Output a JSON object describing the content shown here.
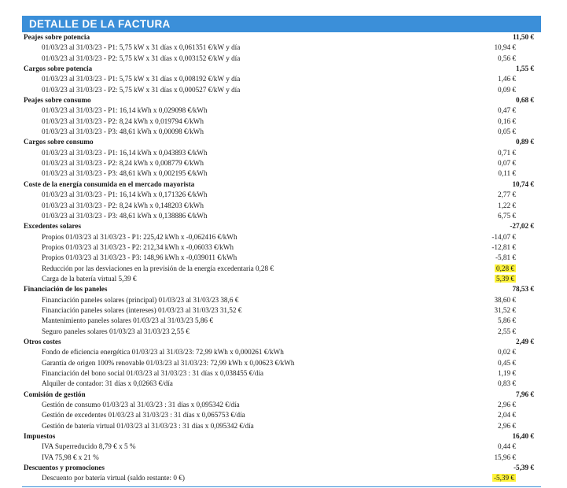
{
  "title": "DETALLE DE LA FACTURA",
  "sections": [
    {
      "label": "Peajes sobre potencia",
      "amount": "11,50 €",
      "items": [
        {
          "label": "01/03/23 al 31/03/23 - P1: 5,75 kW x 31 días x 0,061351 €/kW y día",
          "amount": "10,94 €"
        },
        {
          "label": "01/03/23 al 31/03/23 - P2: 5,75 kW x 31 días x 0,003152 €/kW y día",
          "amount": "0,56 €"
        }
      ]
    },
    {
      "label": "Cargos sobre potencia",
      "amount": "1,55 €",
      "items": [
        {
          "label": "01/03/23 al 31/03/23 - P1: 5,75 kW x 31 días x 0,008192 €/kW y día",
          "amount": "1,46 €"
        },
        {
          "label": "01/03/23 al 31/03/23 - P2: 5,75 kW x 31 días x 0,000527 €/kW y día",
          "amount": "0,09 €"
        }
      ]
    },
    {
      "label": "Peajes sobre consumo",
      "amount": "0,68 €",
      "items": [
        {
          "label": "01/03/23 al 31/03/23 - P1: 16,14 kWh x 0,029098 €/kWh",
          "amount": "0,47 €"
        },
        {
          "label": "01/03/23 al 31/03/23 - P2: 8,24 kWh x 0,019794 €/kWh",
          "amount": "0,16 €"
        },
        {
          "label": "01/03/23 al 31/03/23 - P3: 48,61 kWh x 0,00098 €/kWh",
          "amount": "0,05 €"
        }
      ]
    },
    {
      "label": "Cargos sobre consumo",
      "amount": "0,89 €",
      "items": [
        {
          "label": "01/03/23 al 31/03/23 - P1: 16,14 kWh x 0,043893 €/kWh",
          "amount": "0,71 €"
        },
        {
          "label": "01/03/23 al 31/03/23 - P2: 8,24 kWh x 0,008779 €/kWh",
          "amount": "0,07 €"
        },
        {
          "label": "01/03/23 al 31/03/23 - P3: 48,61 kWh x 0,002195 €/kWh",
          "amount": "0,11 €"
        }
      ]
    },
    {
      "label": "Coste de la energía consumida en el mercado mayorista",
      "amount": "10,74 €",
      "items": [
        {
          "label": "01/03/23 al 31/03/23 - P1: 16,14 kWh x 0,171326 €/kWh",
          "amount": "2,77 €"
        },
        {
          "label": "01/03/23 al 31/03/23 - P2: 8,24 kWh x 0,148203 €/kWh",
          "amount": "1,22 €"
        },
        {
          "label": "01/03/23 al 31/03/23 - P3: 48,61 kWh x 0,138886 €/kWh",
          "amount": "6,75 €"
        }
      ]
    },
    {
      "label": "Excedentes solares",
      "amount": "-27,02 €",
      "items": [
        {
          "label": "Propios 01/03/23 al 31/03/23 - P1: 225,42 kWh x -0,062416 €/kWh",
          "amount": "-14,07 €"
        },
        {
          "label": "Propios 01/03/23 al 31/03/23 - P2: 212,34 kWh x -0,06033 €/kWh",
          "amount": "-12,81 €"
        },
        {
          "label": "Propios 01/03/23 al 31/03/23 - P3: 148,96 kWh x -0,039011 €/kWh",
          "amount": "-5,81 €"
        },
        {
          "label": "Reducción por las desviaciones en la previsión de la energía excedentaria 0,28 €",
          "amount": "0,28 €",
          "highlight": true
        },
        {
          "label": "Carga de la batería virtual 5,39 €",
          "amount": "5,39 €",
          "highlight": true
        }
      ]
    },
    {
      "label": "Financiación de los paneles",
      "amount": "78,53 €",
      "items": [
        {
          "label": "Financiación paneles solares (principal) 01/03/23 al 31/03/23 38,6 €",
          "amount": "38,60 €"
        },
        {
          "label": "Financiación paneles solares (intereses) 01/03/23 al 31/03/23 31,52 €",
          "amount": "31,52 €"
        },
        {
          "label": "Mantenimiento paneles solares 01/03/23 al 31/03/23 5,86 €",
          "amount": "5,86 €"
        },
        {
          "label": "Seguro paneles solares 01/03/23 al 31/03/23 2,55 €",
          "amount": "2,55 €"
        }
      ]
    },
    {
      "label": "Otros costes",
      "amount": "2,49 €",
      "items": [
        {
          "label": "Fondo de eficiencia energética 01/03/23 al 31/03/23: 72,99 kWh x 0,000261 €/kWh",
          "amount": "0,02 €"
        },
        {
          "label": "Garantía de origen 100% renovable 01/03/23 al 31/03/23: 72,99 kWh x 0,00623 €/kWh",
          "amount": "0,45 €"
        },
        {
          "label": "Financiación del bono social 01/03/23 al 31/03/23 : 31 días x 0,038455 €/día",
          "amount": "1,19 €"
        },
        {
          "label": "Alquiler de contador: 31 días x 0,02663 €/día",
          "amount": "0,83 €"
        }
      ]
    },
    {
      "label": "Comisión de gestión",
      "amount": "7,96 €",
      "items": [
        {
          "label": "Gestión de consumo 01/03/23 al 31/03/23 : 31 días x 0,095342 €/día",
          "amount": "2,96 €"
        },
        {
          "label": "Gestión de excedentes 01/03/23 al 31/03/23 : 31 días x 0,065753 €/día",
          "amount": "2,04 €"
        },
        {
          "label": "Gestión de batería virtual 01/03/23 al 31/03/23 : 31 días x 0,095342 €/día",
          "amount": "2,96 €"
        }
      ]
    },
    {
      "label": "Impuestos",
      "amount": "16,40 €",
      "items": [
        {
          "label": "IVA Superreducido 8,79 € x 5 %",
          "amount": "0,44 €"
        },
        {
          "label": "IVA 75,98 € x 21 %",
          "amount": "15,96 €"
        }
      ]
    },
    {
      "label": "Descuentos y promociones",
      "amount": "-5,39 €",
      "items": [
        {
          "label": "Descuento por batería virtual (saldo restante: 0 €)",
          "amount": "-5,39 €",
          "highlight": true
        }
      ]
    }
  ]
}
